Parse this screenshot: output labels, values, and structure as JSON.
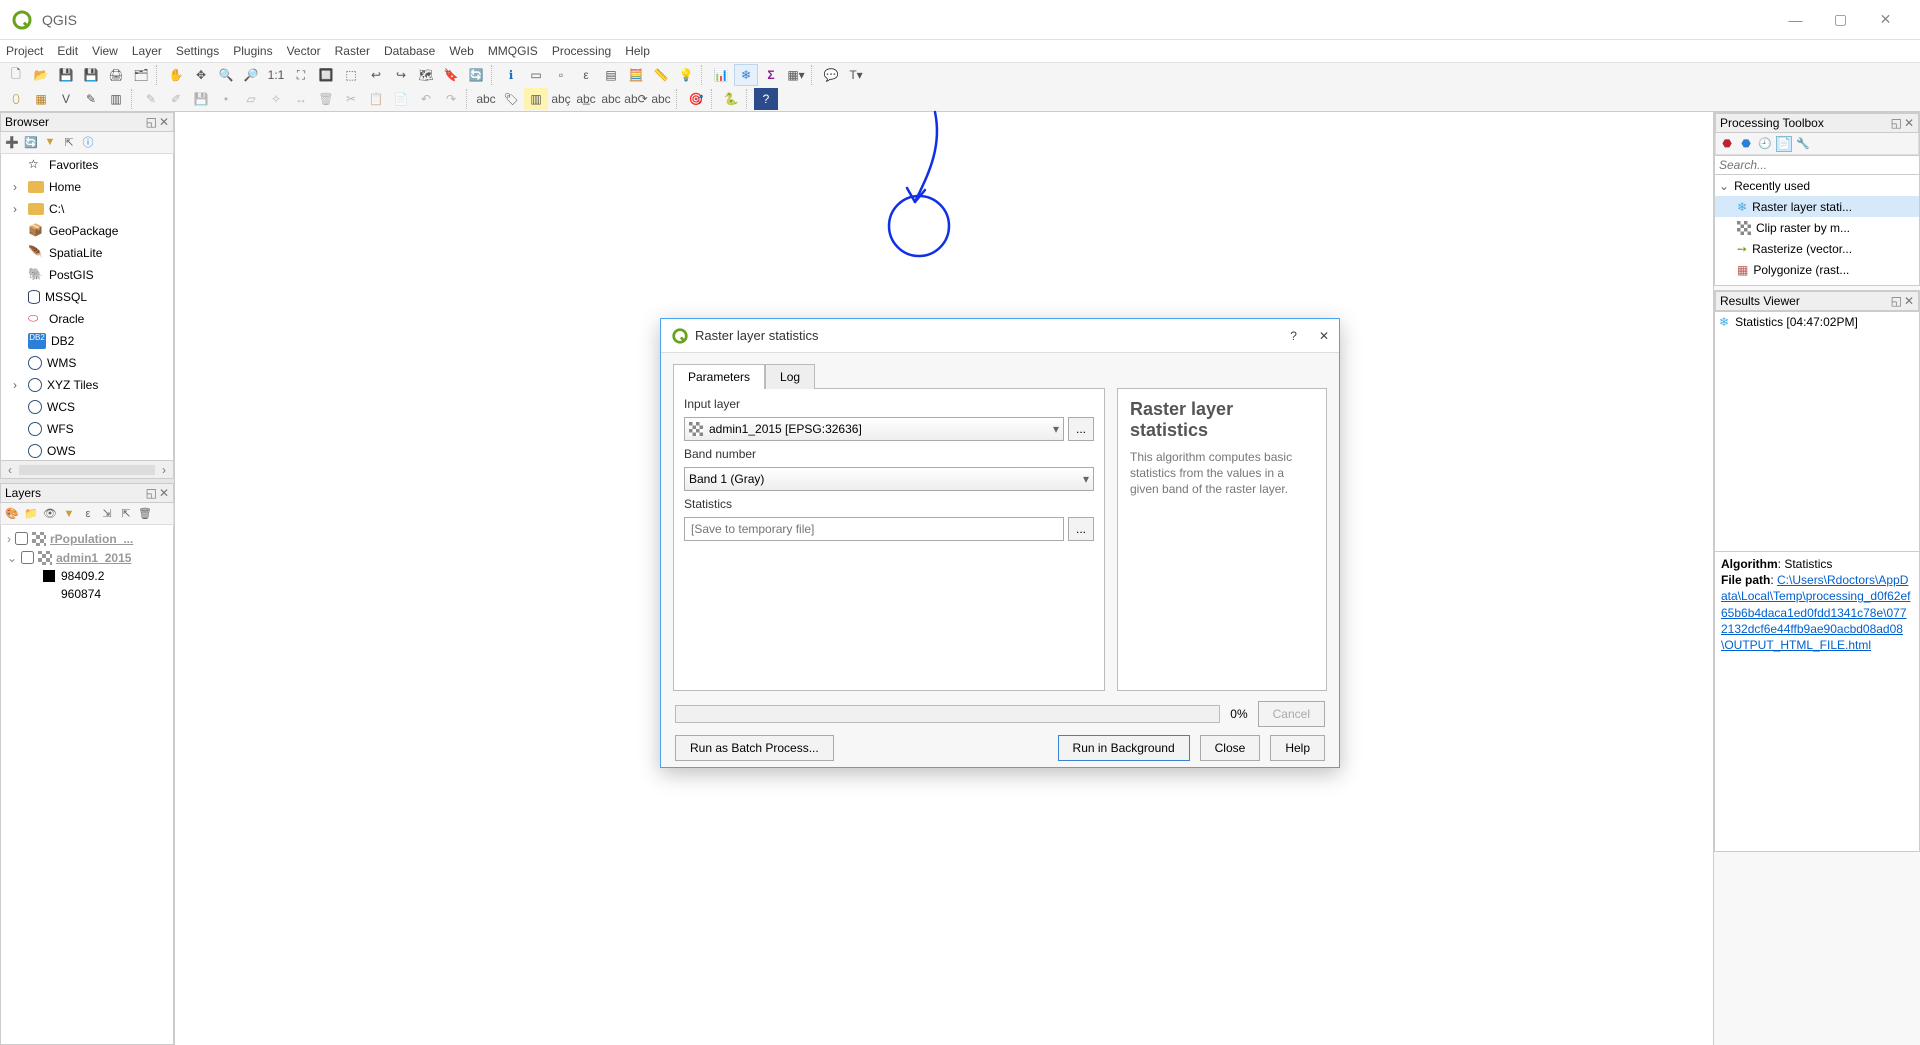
{
  "app": {
    "title": "QGIS"
  },
  "menu": [
    "Project",
    "Edit",
    "View",
    "Layer",
    "Settings",
    "Plugins",
    "Vector",
    "Raster",
    "Database",
    "Web",
    "MMQGIS",
    "Processing",
    "Help"
  ],
  "browser": {
    "title": "Browser",
    "items": [
      {
        "label": "Favorites",
        "expandable": false,
        "icon": "star"
      },
      {
        "label": "Home",
        "expandable": true,
        "icon": "folder"
      },
      {
        "label": "C:\\",
        "expandable": true,
        "icon": "folder"
      },
      {
        "label": "GeoPackage",
        "expandable": false,
        "icon": "box"
      },
      {
        "label": "SpatiaLite",
        "expandable": false,
        "icon": "feather"
      },
      {
        "label": "PostGIS",
        "expandable": false,
        "icon": "elephant"
      },
      {
        "label": "MSSQL",
        "expandable": false,
        "icon": "db"
      },
      {
        "label": "Oracle",
        "expandable": false,
        "icon": "db-red"
      },
      {
        "label": "DB2",
        "expandable": false,
        "icon": "db2"
      },
      {
        "label": "WMS",
        "expandable": false,
        "icon": "globe"
      },
      {
        "label": "XYZ Tiles",
        "expandable": true,
        "icon": "globe"
      },
      {
        "label": "WCS",
        "expandable": false,
        "icon": "globe"
      },
      {
        "label": "WFS",
        "expandable": false,
        "icon": "globe"
      },
      {
        "label": "OWS",
        "expandable": false,
        "icon": "globe"
      }
    ]
  },
  "layers_panel": {
    "title": "Layers",
    "layers": [
      {
        "name": "rPopulation_...",
        "checked": false
      },
      {
        "name": "admin1_2015",
        "checked": false
      }
    ],
    "legend": [
      "98409.2",
      "960874"
    ]
  },
  "toolbox": {
    "title": "Processing Toolbox",
    "search_placeholder": "Search...",
    "group": "Recently used",
    "items": [
      "Raster layer stati...",
      "Clip raster by m...",
      "Rasterize (vector...",
      "Polygonize (rast..."
    ]
  },
  "results": {
    "title": "Results Viewer",
    "items": [
      "Statistics [04:47:02PM]"
    ],
    "log_algorithm_label": "Algorithm",
    "log_algorithm_value": "Statistics",
    "log_filepath_label": "File path",
    "log_filepath_value": "C:\\Users\\Rdoctors\\AppData\\Local\\Temp\\processing_d0f62ef65b6b4daca1ed0fdd1341c78e\\0772132dcf6e44ffb9ae90acbd08ad08\\OUTPUT_HTML_FILE.html"
  },
  "dialog": {
    "title": "Raster layer statistics",
    "tabs": [
      "Parameters",
      "Log"
    ],
    "input_layer_label": "Input layer",
    "input_layer_value": "admin1_2015 [EPSG:32636]",
    "band_label": "Band number",
    "band_value": "Band 1 (Gray)",
    "stats_label": "Statistics",
    "stats_placeholder": "[Save to temporary file]",
    "desc_title": "Raster layer statistics",
    "desc_body": "This algorithm computes basic statistics from the values in a given band of the raster layer.",
    "progress_pct": "0%",
    "btn_batch": "Run as Batch Process...",
    "btn_runbg": "Run in Background",
    "btn_close": "Close",
    "btn_help": "Help",
    "btn_cancel": "Cancel"
  }
}
